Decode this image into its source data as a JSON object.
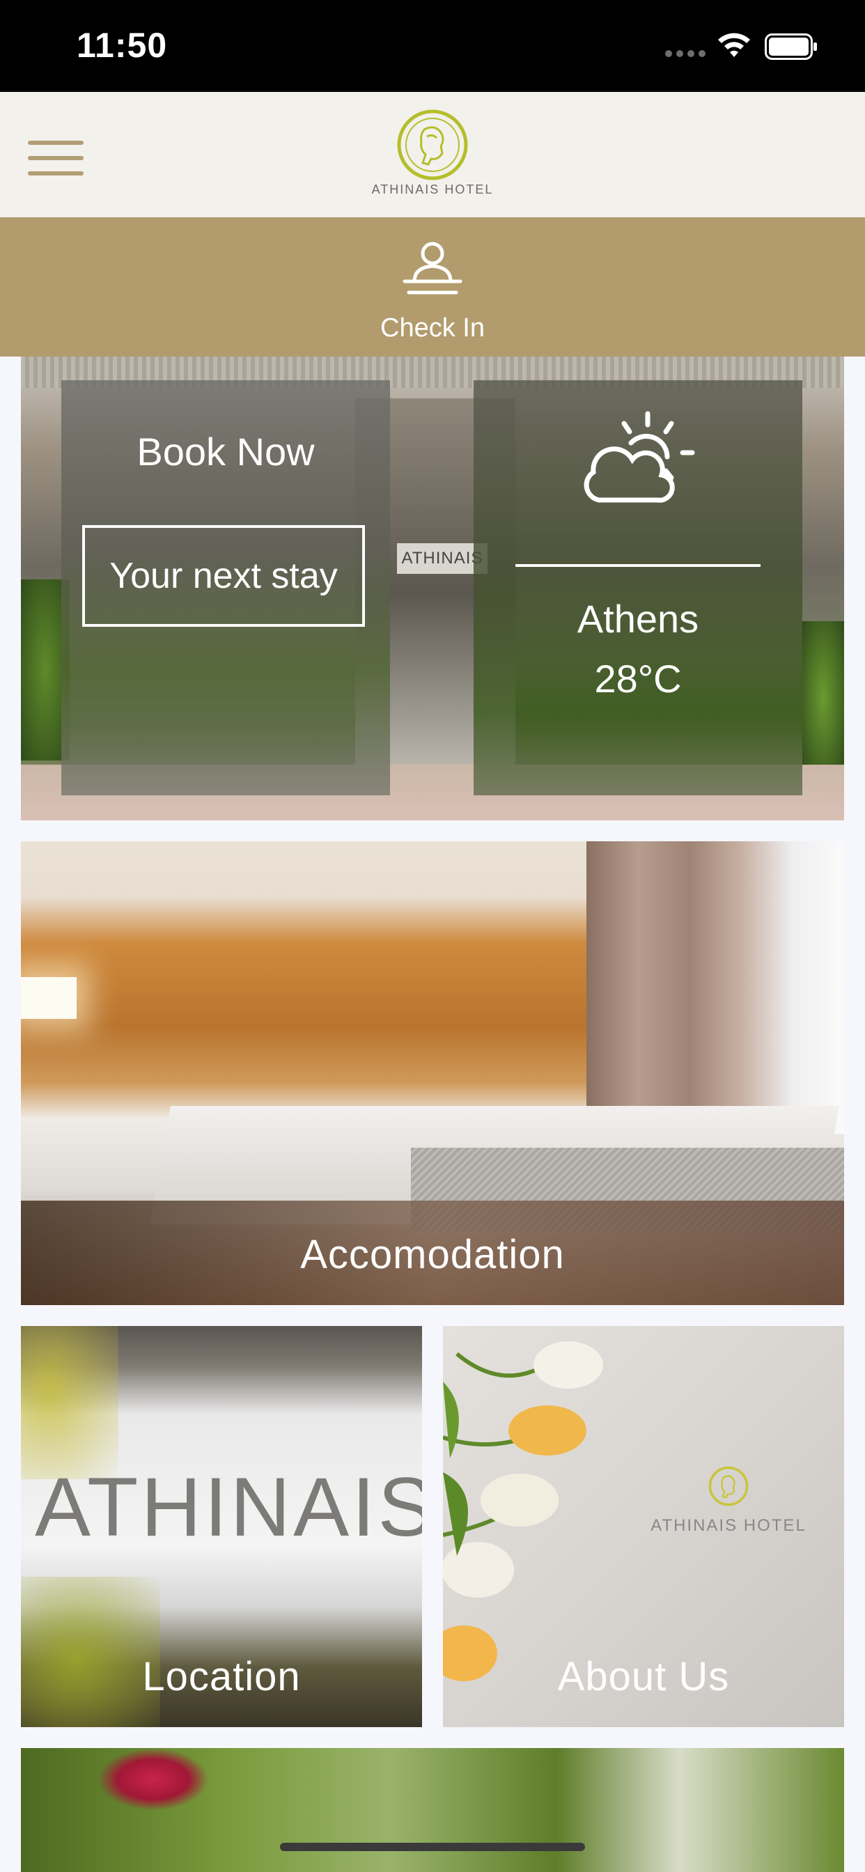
{
  "status_bar": {
    "time": "11:50",
    "icons": [
      "signal-icon",
      "wifi-icon",
      "battery-icon"
    ]
  },
  "header": {
    "menu_icon": "hamburger-menu-icon",
    "logo_text": "ATHINAIS HOTEL"
  },
  "checkin": {
    "label": "Check In",
    "icon": "check-in-icon"
  },
  "hero": {
    "sign_text": "ATHINAIS",
    "book": {
      "title": "Book Now",
      "button_label": "Your next stay"
    },
    "weather": {
      "icon": "partly-cloudy-icon",
      "city": "Athens",
      "temperature": "28°C"
    }
  },
  "tiles": {
    "accommodation": "Accomodation",
    "location": "Location",
    "location_sign": "ATHINAIS H",
    "about": "About Us",
    "about_logo_text": "ATHINAIS HOTEL"
  },
  "colors": {
    "header_bg": "#f3f1ec",
    "accent_gold": "#b29c6d",
    "logo_green": "#b5be2a",
    "page_bg": "#f6f7fc"
  }
}
